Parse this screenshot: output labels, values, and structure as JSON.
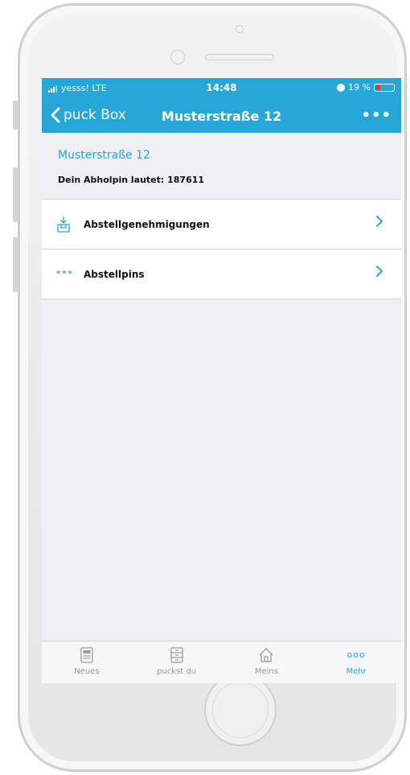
{
  "status_bar": {
    "carrier": "yesss! LTE",
    "time": "14:48",
    "battery": "19 %"
  },
  "nav": {
    "back_label": "puck Box",
    "title": "Musterstraße 12",
    "more_label": "•••"
  },
  "header": {
    "address": "Musterstraße 12",
    "pin_text": "Dein Abholpin lautet: 187611"
  },
  "list": {
    "items": [
      {
        "label": "Abstellgenehmigungen",
        "icon": "package-download-icon"
      },
      {
        "label": "Abstellpins",
        "icon_text": "***",
        "icon": "pin-dots-icon"
      }
    ]
  },
  "tabs": [
    {
      "label": "Neues",
      "icon": "newspaper-icon",
      "active": false
    },
    {
      "label": "puckst du",
      "icon": "cabinet-icon",
      "active": false
    },
    {
      "label": "Meins",
      "icon": "home-icon",
      "active": false
    },
    {
      "label": "Mehr",
      "icon_text": "ooo",
      "icon": "more-icon",
      "active": true
    }
  ],
  "colors": {
    "accent": "#26a7d8",
    "battery_low": "#e53935"
  }
}
